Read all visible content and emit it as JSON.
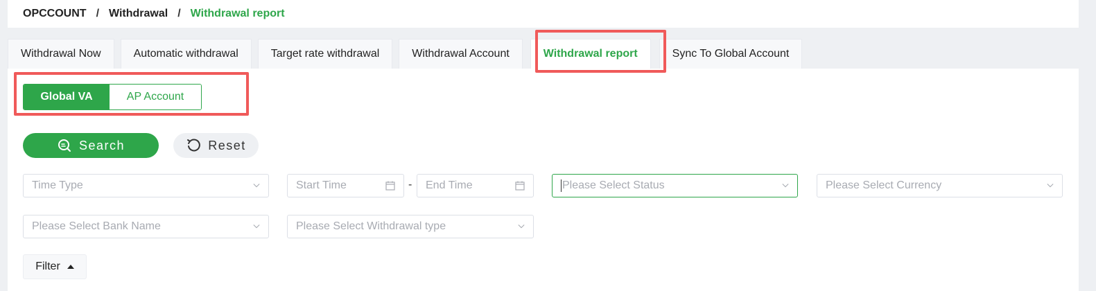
{
  "breadcrumb": {
    "root": "OPCCOUNT",
    "level1": "Withdrawal",
    "current": "Withdrawal report",
    "separator": "/"
  },
  "tabs": [
    {
      "label": "Withdrawal Now"
    },
    {
      "label": "Automatic withdrawal"
    },
    {
      "label": "Target rate withdrawal"
    },
    {
      "label": "Withdrawal Account"
    },
    {
      "label": "Withdrawal report",
      "active": true
    },
    {
      "label": "Sync To Global Account"
    }
  ],
  "segment": {
    "option1": "Global VA",
    "option2": "AP Account",
    "selected": "Global VA"
  },
  "actions": {
    "search_label": "Search",
    "reset_label": "Reset"
  },
  "filters": {
    "time_type": "Time Type",
    "start_time": "Start Time",
    "range_sep": "-",
    "end_time": "End Time",
    "status": "Please Select Status",
    "currency": "Please Select Currency",
    "bank_name": "Please Select Bank Name",
    "withdrawal_type": "Please Select Withdrawal type"
  },
  "filter_toggle": {
    "label": "Filter"
  },
  "colors": {
    "accent": "#2ea64a",
    "highlight": "#f05a5a",
    "background": "#eef0f3"
  },
  "icons": [
    "search-icon",
    "reset-icon",
    "chevron-down-icon",
    "calendar-icon",
    "caret-up-icon"
  ]
}
